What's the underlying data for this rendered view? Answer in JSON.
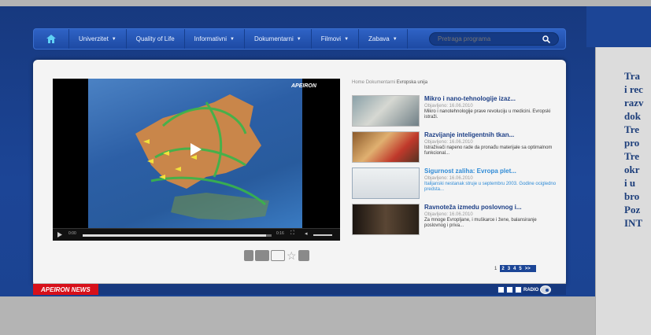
{
  "nav": {
    "home_icon": "home-icon",
    "items": [
      {
        "label": "Univerzitet",
        "has_dropdown": true
      },
      {
        "label": "Quality of Life",
        "has_dropdown": false
      },
      {
        "label": "Informativni",
        "has_dropdown": true
      },
      {
        "label": "Dokumentarni",
        "has_dropdown": true
      },
      {
        "label": "Filmovi",
        "has_dropdown": true
      },
      {
        "label": "Zabava",
        "has_dropdown": true
      }
    ],
    "search": {
      "placeholder": "Pretraga programa",
      "icon": "search-icon"
    }
  },
  "player": {
    "brand": "APEIRON",
    "current_time": "0:00",
    "end_time": "0:16",
    "progress": 0.97
  },
  "breadcrumb": {
    "items": [
      "Home",
      "Dokumentarni",
      "Evropska unija"
    ]
  },
  "videos": [
    {
      "title": "Mikro i nano-tehnologije izaz...",
      "date": "Objavljeno: 16.06.2010",
      "desc": "Mikro i nanotehnologije prave revoluciju u medicini. Evropski istraži."
    },
    {
      "title": "Razvijanje inteligentnih tkan...",
      "date": "Objavljeno: 16.06.2010",
      "desc": "Istraživači napeno rade da pronađu materijale sa optimalnom funkcional..."
    },
    {
      "title": "Sigurnost zaliha: Evropa plet...",
      "date": "Objavljeno: 16.06.2010",
      "desc": "Italijanski nestanak struje u septembru 2003. Godine ocigledno predsta..."
    },
    {
      "title": "Ravnoteža izmedu poslovnog i...",
      "date": "Objavljeno: 16.06.2010",
      "desc": "Za mnoge Evropljane, i muškarce i žene, balansiranje poslovnog i priva..."
    }
  ],
  "share_icons": [
    "info-icon",
    "comment-icon",
    "mail-icon",
    "star-icon",
    "facebook-icon"
  ],
  "pager": {
    "current": "1",
    "pages": [
      "2",
      "3",
      "4",
      "5",
      ">>"
    ]
  },
  "news_logo": "APEIRON NEWS",
  "radio": {
    "label": "RADIO"
  },
  "sidebox": {
    "text": "Tra\ni rec\nrazv\ndok\nTre\npro\nTre\nokr\ni u\nbro\nPoz\nINT"
  },
  "colors": {
    "accent": "#1b4596",
    "highlight": "#2f8bd6",
    "news_red": "#d7101a"
  }
}
